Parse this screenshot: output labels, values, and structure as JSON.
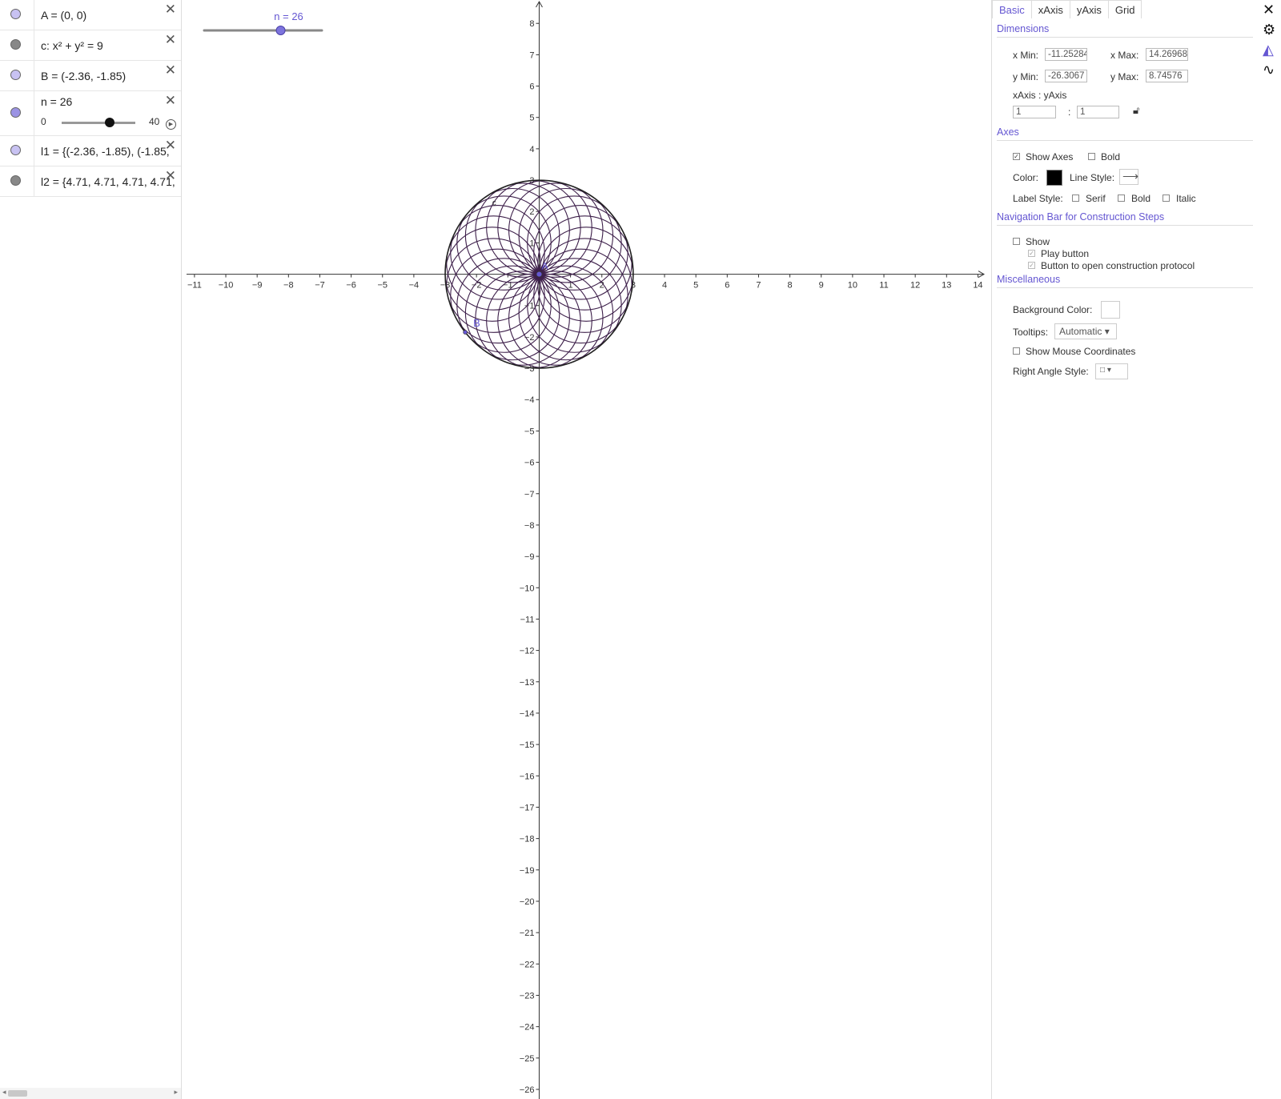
{
  "algebra": {
    "rows": [
      {
        "text": "A = (0, 0)",
        "marble": "#c8c2f2"
      },
      {
        "text": "c: x² + y² = 9",
        "marble": "#888888"
      },
      {
        "text": "B = (-2.36, -1.85)",
        "marble": "#c8c2f2"
      },
      {
        "text": "n = 26",
        "marble": "#9b93e4",
        "slider": {
          "min": "0",
          "max": "40",
          "value": 26
        }
      },
      {
        "text": "l1 = {(-2.36, -1.85), (-1.85,",
        "marble": "#c8c2f2"
      },
      {
        "text": "l2 = {4.71, 4.71, 4.71, 4.71,",
        "marble": "#888888"
      }
    ],
    "close_glyph": "✕",
    "play_glyph": "▶"
  },
  "graphics": {
    "slider_label": "n = 26",
    "slider": {
      "min": 0,
      "max": 40,
      "value": 26
    },
    "point_labels": {
      "A": "A",
      "B": "B",
      "c": "c"
    },
    "xlim": [
      -11.25284,
      14.26968
    ],
    "ylim": [
      -26.3067,
      8.74576
    ],
    "x_ticks": [
      -11,
      -10,
      -9,
      -8,
      -7,
      -6,
      -5,
      -4,
      -3,
      -2,
      -1,
      1,
      2,
      3,
      4,
      5,
      6,
      7,
      8,
      9,
      10,
      11,
      12,
      13,
      14
    ],
    "y_ticks": [
      8,
      7,
      6,
      5,
      4,
      3,
      2,
      1,
      -1,
      -2,
      -3,
      -4,
      -5,
      -6,
      -7,
      -8,
      -9,
      -10,
      -11,
      -12,
      -13,
      -14,
      -15,
      -16,
      -17,
      -18,
      -19,
      -20,
      -21,
      -22,
      -23,
      -24,
      -25,
      -26
    ],
    "circle_radius": 3,
    "petal_count": 26,
    "curve_color": "#3d1f4a",
    "point_color": "#6557d2"
  },
  "settings": {
    "tabs": [
      "Basic",
      "xAxis",
      "yAxis",
      "Grid"
    ],
    "dimensions_title": "Dimensions",
    "xmin_label": "x Min:",
    "xmin_value": "-11.25284",
    "xmax_label": "x Max:",
    "xmax_value": "14.26968",
    "ymin_label": "y Min:",
    "ymin_value": "-26.3067",
    "ymax_label": "y Max:",
    "ymax_value": "8.74576",
    "ratio_label": "xAxis : yAxis",
    "ratio_x": "1",
    "ratio_sep": ":",
    "ratio_y": "1",
    "axes_title": "Axes",
    "show_axes": "Show Axes",
    "bold": "Bold",
    "color_label": "Color:",
    "line_style_label": "Line Style:",
    "line_style_glyph": "⟶",
    "label_style_label": "Label Style:",
    "serif": "Serif",
    "italic": "Italic",
    "nav_title": "Navigation Bar for Construction Steps",
    "nav_show": "Show",
    "play_button": "Play button",
    "open_protocol": "Button to open construction protocol",
    "misc_title": "Miscellaneous",
    "bg_color_label": "Background Color:",
    "tooltips_label": "Tooltips:",
    "tooltips_value": "Automatic ▾",
    "mouse_coords": "Show Mouse Coordinates",
    "right_angle_label": "Right Angle Style:",
    "right_angle_value": "□ ▾",
    "check_glyph": "✓"
  },
  "sidebar": {
    "close": "✕",
    "gear": "⚙",
    "graphics": "◭",
    "graph": "∿"
  }
}
